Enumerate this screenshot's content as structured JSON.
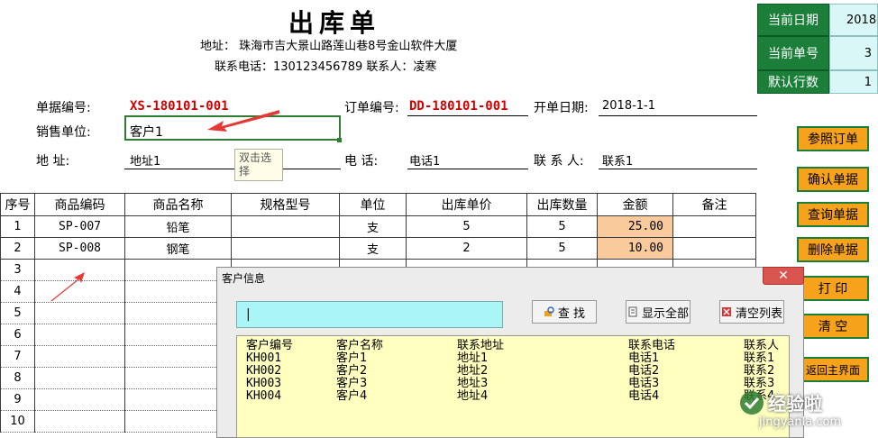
{
  "header": {
    "title": "出库单",
    "address": "地址：  珠海市吉大景山路莲山巷8号金山软件大厦",
    "contact": "联系电话：130123456789   联系人：凌寒"
  },
  "form": {
    "doc_no_label": "单据编号:",
    "doc_no": "XS-180101-001",
    "order_no_label": "订单编号:",
    "order_no": "DD-180101-001",
    "date_label": "开单日期:",
    "date": "2018-1-1",
    "unit_label": "销售单位:",
    "unit": "客户1",
    "addr_label": "地    址:",
    "addr": "地址1",
    "tel_label": "电    话:",
    "tel": "电话1",
    "person_label": "联 系 人:",
    "person": "联系1",
    "tooltip": "双击选择"
  },
  "info_panel": {
    "current_date_label": "当前日期",
    "current_date": "2018-",
    "current_no_label": "当前单号",
    "current_no": "3",
    "default_rows_label": "默认行数",
    "default_rows": "1"
  },
  "buttons": {
    "ref_order": "参照订单",
    "confirm": "确认单据",
    "query": "查询单据",
    "delete": "删除单据",
    "print": "打    印",
    "clear": "清    空",
    "back": "返回主界面"
  },
  "table": {
    "columns": [
      "序号",
      "商品编码",
      "商品名称",
      "规格型号",
      "单位",
      "出库单价",
      "出库数量",
      "金额",
      "备注"
    ],
    "rows": [
      [
        "1",
        "SP-007",
        "铅笔",
        "",
        "支",
        "5",
        "5",
        "25.00",
        ""
      ],
      [
        "2",
        "SP-008",
        "钢笔",
        "",
        "支",
        "2",
        "5",
        "10.00",
        ""
      ],
      [
        "3",
        "",
        "",
        "",
        "",
        "",
        "",
        "",
        ""
      ],
      [
        "4",
        "",
        "",
        "",
        "",
        "",
        "",
        "",
        ""
      ],
      [
        "5",
        "",
        "",
        "",
        "",
        "",
        "",
        "",
        ""
      ],
      [
        "6",
        "",
        "",
        "",
        "",
        "",
        "",
        "",
        ""
      ],
      [
        "7",
        "",
        "",
        "",
        "",
        "",
        "",
        "",
        ""
      ],
      [
        "8",
        "",
        "",
        "",
        "",
        "",
        "",
        "",
        ""
      ],
      [
        "9",
        "",
        "",
        "",
        "",
        "",
        "",
        "",
        ""
      ],
      [
        "10",
        "",
        "",
        "",
        "",
        "",
        "",
        "",
        ""
      ]
    ]
  },
  "dialog": {
    "title": "客户信息",
    "close": "✕",
    "search_value": "|",
    "find_label": "查  找",
    "show_all_label": "显示全部",
    "clear_list_label": "清空列表",
    "list_header": [
      "客户编号",
      "客户名称",
      "联系地址",
      "联系电话",
      "联系人"
    ],
    "list_rows": [
      [
        "KH001",
        "客户1",
        "地址1",
        "电话1",
        "联系1"
      ],
      [
        "KH002",
        "客户2",
        "地址2",
        "电话2",
        "联系2"
      ],
      [
        "KH003",
        "客户3",
        "地址3",
        "电话3",
        "联系3"
      ],
      [
        "KH004",
        "客户4",
        "地址4",
        "电话4",
        "联系4"
      ]
    ]
  },
  "watermark": {
    "line1": "经验啦",
    "line2": "jingyanla.com"
  },
  "colors": {
    "accent_green": "#1b7f3a",
    "button_orange": "#f7a21b",
    "amount_fill": "#f9cb9c",
    "doc_no_red": "#d10000",
    "list_bg": "#ffffc0",
    "search_bg": "#aaf5f5"
  }
}
